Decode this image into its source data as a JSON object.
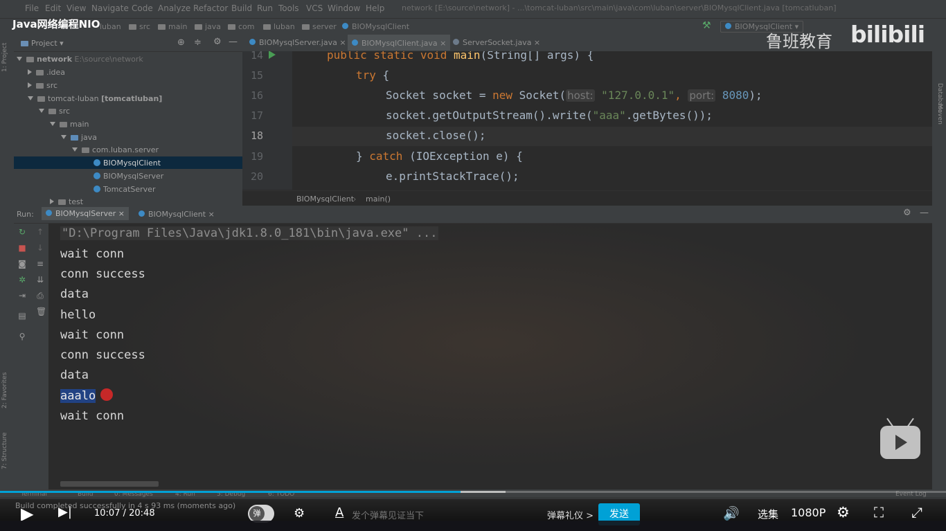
{
  "video_title": "Java网络编程NIO",
  "ide": {
    "menu": [
      "File",
      "Edit",
      "View",
      "Navigate",
      "Code",
      "Analyze",
      "Refactor",
      "Build",
      "Run",
      "Tools",
      "VCS",
      "Window",
      "Help"
    ],
    "window_title": "network [E:\\source\\network] - ...\\tomcat-luban\\src\\main\\java\\com\\luban\\server\\BIOMysqlClient.java [tomcatluban]",
    "breadcrumbs": [
      "luban",
      "src",
      "main",
      "java",
      "com",
      "luban",
      "server",
      "BIOMysqlClient"
    ],
    "run_config": "BIOMysqlClient",
    "project_panel": {
      "title": "Project",
      "stripe_labels": [
        "1: Project",
        "2: Favorites",
        "7: Structure"
      ],
      "tree": [
        {
          "label": "network",
          "note": "E:\\source\\network"
        },
        {
          "label": ".idea"
        },
        {
          "label": "src"
        },
        {
          "label": "tomcat-luban",
          "note": "[tomcatluban]"
        },
        {
          "label": "src"
        },
        {
          "label": "main"
        },
        {
          "label": "java"
        },
        {
          "label": "com.luban.server"
        },
        {
          "label": "BIOMysqlClient"
        },
        {
          "label": "BIOMysqlServer"
        },
        {
          "label": "TomcatServer"
        },
        {
          "label": "test"
        }
      ]
    },
    "editor_tabs": [
      "BIOMysqlServer.java",
      "BIOMysqlClient.java",
      "ServerSocket.java"
    ],
    "editor": {
      "line_numbers": [
        "14",
        "15",
        "16",
        "17",
        "18",
        "19",
        "20"
      ],
      "crumbs": [
        "BIOMysqlClient",
        "main()"
      ],
      "code": {
        "l14_kw": "public static void ",
        "l14_fn": "main",
        "l14_rest": "(String[] args) {",
        "l15_kw": "try",
        "l15_rest": " {",
        "l16_a": "Socket socket = ",
        "l16_kw": "new",
        "l16_b": " Socket(",
        "l16_hint1": "host:",
        "l16_str": "\"127.0.0.1\"",
        "l16_c": ", ",
        "l16_hint2": "port:",
        "l16_num": "8080",
        "l16_d": ");",
        "l17_a": "socket.getOutputStream().write(",
        "l17_str": "\"aaa\"",
        "l17_b": ".getBytes());",
        "l18": "socket.close();",
        "l19_a": "} ",
        "l19_kw": "catch",
        "l19_b": " (IOException e) {",
        "l20": "e.printStackTrace();"
      }
    },
    "right_stripe": [
      "Database",
      "Maven"
    ],
    "run_panel": {
      "label": "Run:",
      "tabs": [
        "BIOMysqlServer",
        "BIOMysqlClient"
      ],
      "console": [
        "\"D:\\Program Files\\Java\\jdk1.8.0_181\\bin\\java.exe\" ...",
        "wait conn",
        "conn success",
        "data",
        "hello",
        "wait conn",
        "conn success",
        "data",
        "aaalo",
        "wait conn"
      ]
    },
    "bottom_tools": [
      "Terminal",
      "Build",
      "0: Messages",
      "4: Run",
      "5: Debug",
      "6: TODO",
      "Event Log"
    ],
    "status": "Build completed successfully in 4 s 93 ms (moments ago)"
  },
  "player": {
    "time_current": "10:07",
    "time_total": "20:48",
    "progress": 0.487,
    "danmaku_toggle_label": "弹",
    "danmaku_placeholder": "发个弹幕见证当下",
    "etiquette": "弹幕礼仪 >",
    "send": "发送",
    "episodes": "选集",
    "quality": "1080P",
    "accent_color": "#00a1d6"
  },
  "watermark": {
    "brand": "鲁班教育",
    "site": "bilibili"
  }
}
